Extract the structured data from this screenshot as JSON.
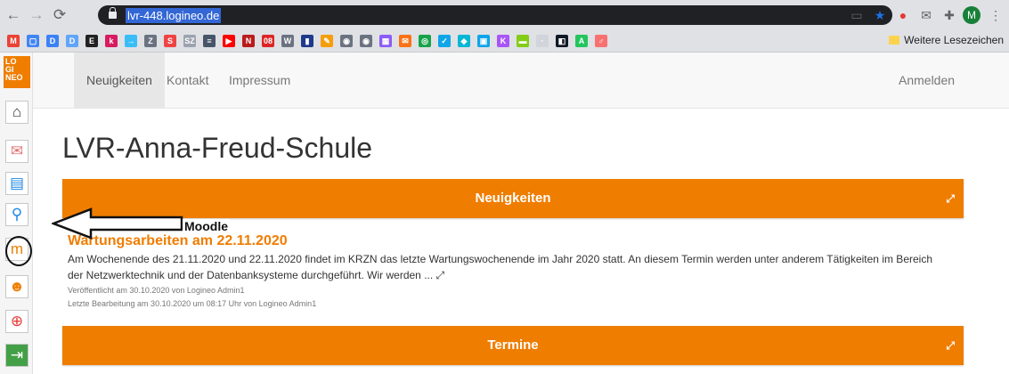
{
  "browser": {
    "url": "lvr-448.logineo.de",
    "avatar_letter": "M",
    "bookmarks_folder": "Weitere Lesezeichen",
    "bookmark_icons": [
      {
        "name": "gmail",
        "color": "#ea4335",
        "glyph": "M"
      },
      {
        "name": "calendar",
        "color": "#4285f4",
        "glyph": "▢"
      },
      {
        "name": "dkb",
        "color": "#3b82f6",
        "glyph": "D"
      },
      {
        "name": "dkb2",
        "color": "#60a5fa",
        "glyph": "D"
      },
      {
        "name": "e",
        "color": "#222222",
        "glyph": "E"
      },
      {
        "name": "kt",
        "color": "#d81b60",
        "glyph": "k"
      },
      {
        "name": "arrow",
        "color": "#38bdf8",
        "glyph": "→"
      },
      {
        "name": "z",
        "color": "#6b7280",
        "glyph": "Z"
      },
      {
        "name": "s",
        "color": "#ef4444",
        "glyph": "S"
      },
      {
        "name": "sz",
        "color": "#9ca3af",
        "glyph": "SZ"
      },
      {
        "name": "news",
        "color": "#475569",
        "glyph": "≡"
      },
      {
        "name": "youtube",
        "color": "#ff0000",
        "glyph": "▶"
      },
      {
        "name": "netflix",
        "color": "#b91c1c",
        "glyph": "N"
      },
      {
        "name": "cal08",
        "color": "#dc2626",
        "glyph": "08"
      },
      {
        "name": "wiki",
        "color": "#6b7280",
        "glyph": "W"
      },
      {
        "name": "book",
        "color": "#1e3a8a",
        "glyph": "▮"
      },
      {
        "name": "paint",
        "color": "#f59e0b",
        "glyph": "✎"
      },
      {
        "name": "globe1",
        "color": "#6b7280",
        "glyph": "◉"
      },
      {
        "name": "globe2",
        "color": "#6b7280",
        "glyph": "◉"
      },
      {
        "name": "grid",
        "color": "#8b5cf6",
        "glyph": "▦"
      },
      {
        "name": "mail",
        "color": "#f97316",
        "glyph": "✉"
      },
      {
        "name": "ring",
        "color": "#16a34a",
        "glyph": "◎"
      },
      {
        "name": "check",
        "color": "#0ea5e9",
        "glyph": "✓"
      },
      {
        "name": "drop",
        "color": "#06b6d4",
        "glyph": "◆"
      },
      {
        "name": "sq",
        "color": "#0ea5e9",
        "glyph": "▣"
      },
      {
        "name": "k",
        "color": "#a855f7",
        "glyph": "K"
      },
      {
        "name": "pill",
        "color": "#84cc16",
        "glyph": "▬"
      },
      {
        "name": "faded",
        "color": "#d1d5db",
        "glyph": "·"
      },
      {
        "name": "cp",
        "color": "#111827",
        "glyph": "◧"
      },
      {
        "name": "ab",
        "color": "#22c55e",
        "glyph": "A"
      },
      {
        "name": "red",
        "color": "#f87171",
        "glyph": "♂"
      }
    ]
  },
  "logo_text": "LO\nGI\nNEO",
  "nav": {
    "items": [
      "Neuigkeiten",
      "Kontakt",
      "Impressum"
    ],
    "login": "Anmelden"
  },
  "page_title": "LVR-Anna-Freud-Schule",
  "panels": {
    "news_header": "Neuigkeiten",
    "events_header": "Termine"
  },
  "article": {
    "title": "Wartungsarbeiten am 22.11.2020",
    "body": "Am Wochenende des 21.11.2020 und 22.11.2020 findet im KRZN das letzte Wartungswochenende im Jahr 2020 statt. An diesem Termin werden unter anderem Tätigkeiten im Bereich der Netzwerktechnik und der Datenbanksysteme durchgeführt. Wir werden ... ",
    "published": "Veröffentlicht am 30.10.2020 von Logineo Admin1",
    "last_edit": "Letzte Bearbeitung am 30.10.2020 um 08:17 Uhr von Logineo Admin1"
  },
  "annotation": {
    "label": "Moodle"
  },
  "colors": {
    "accent": "#ef7d00",
    "chrome": "#dfe1e5",
    "omnibox": "#202124"
  },
  "sidebar_icons": [
    "home-icon",
    "mail-icon",
    "folder-icon",
    "search-people-icon",
    "moodle-icon",
    "users-icon",
    "help-lifebuoy-icon",
    "exit-icon"
  ]
}
